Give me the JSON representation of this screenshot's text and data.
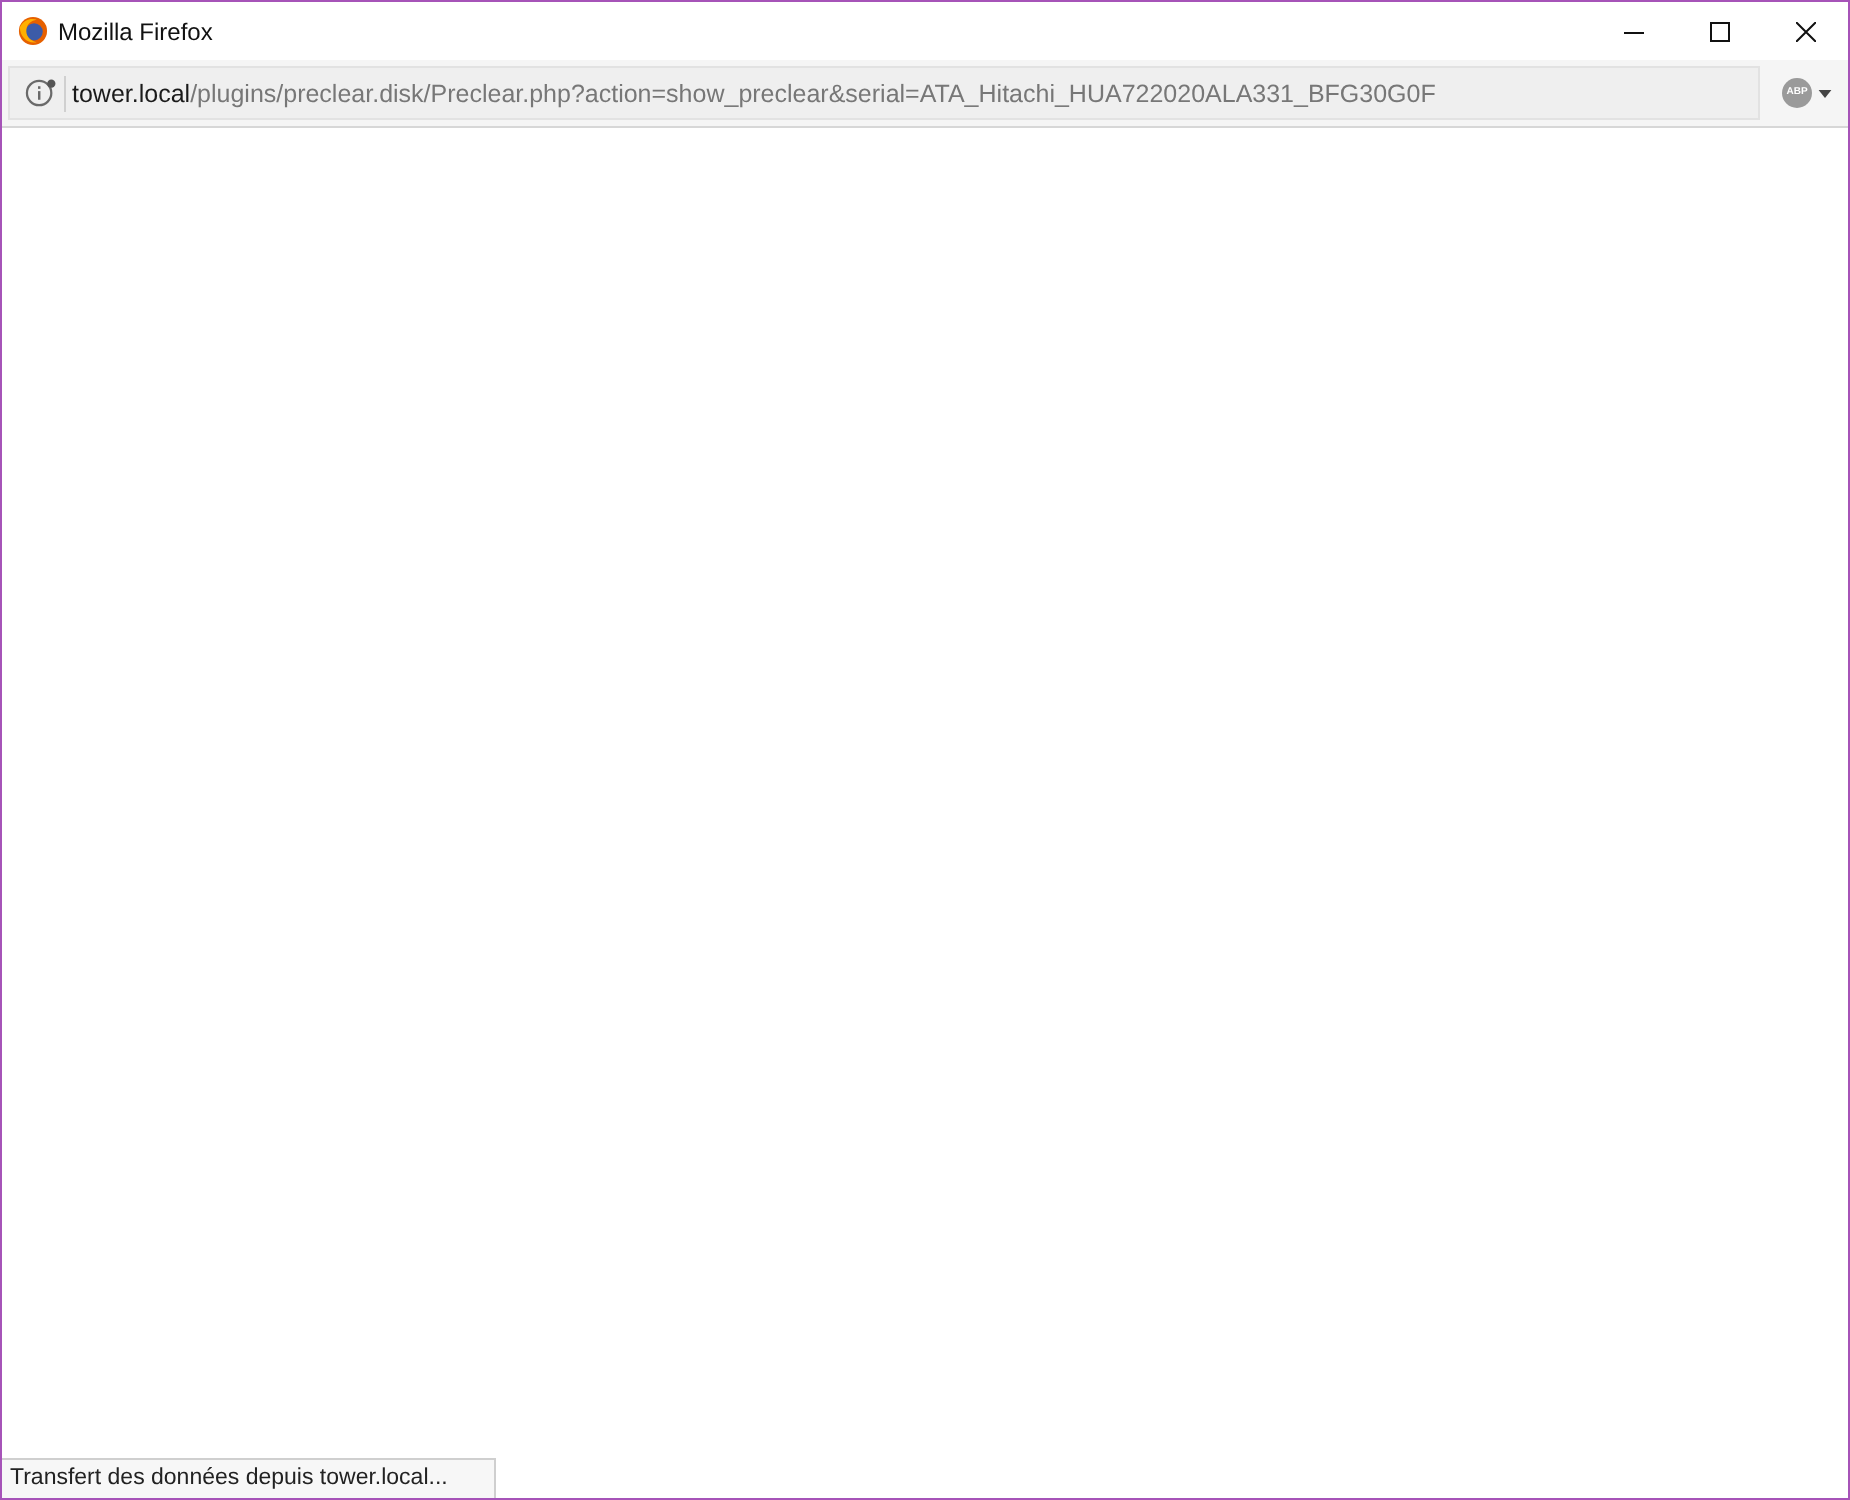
{
  "window": {
    "title": "Mozilla Firefox",
    "controls": [
      {
        "kind": "minimize"
      },
      {
        "kind": "maximize"
      },
      {
        "kind": "close"
      }
    ]
  },
  "address_bar": {
    "host": "tower.local",
    "path": "/plugins/preclear.disk/Preclear.php?action=show_preclear&serial=ATA_Hitachi_HUA722020ALA331_BFG30G0F"
  },
  "toolbar": {
    "adblock_button": {
      "label": "ABP"
    }
  },
  "status_bar": {
    "text": "Transfert des données depuis tower.local..."
  }
}
